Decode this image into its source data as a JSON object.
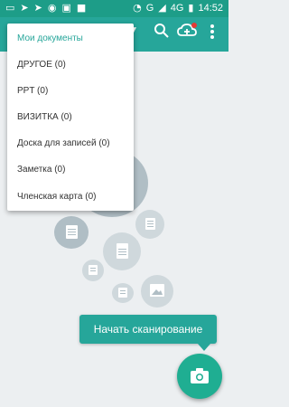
{
  "status_bar": {
    "carrier_letter": "G",
    "network": "4G",
    "time": "14:52"
  },
  "menu": {
    "items": [
      {
        "label": "Мои документы",
        "active": true
      },
      {
        "label": "ДРУГОЕ (0)",
        "active": false
      },
      {
        "label": "PPT (0)",
        "active": false
      },
      {
        "label": "ВИЗИТКА (0)",
        "active": false
      },
      {
        "label": "Доска для записей (0)",
        "active": false
      },
      {
        "label": "Заметка (0)",
        "active": false
      },
      {
        "label": "Членская карта (0)",
        "active": false
      }
    ]
  },
  "tooltip": {
    "text": "Начать сканирование"
  },
  "colors": {
    "accent": "#26a69a",
    "status_bar": "#1d9d88",
    "background": "#eceff1"
  },
  "icons": [
    "search-icon",
    "cloud-upload-icon",
    "more-vert-icon",
    "camera-icon"
  ]
}
